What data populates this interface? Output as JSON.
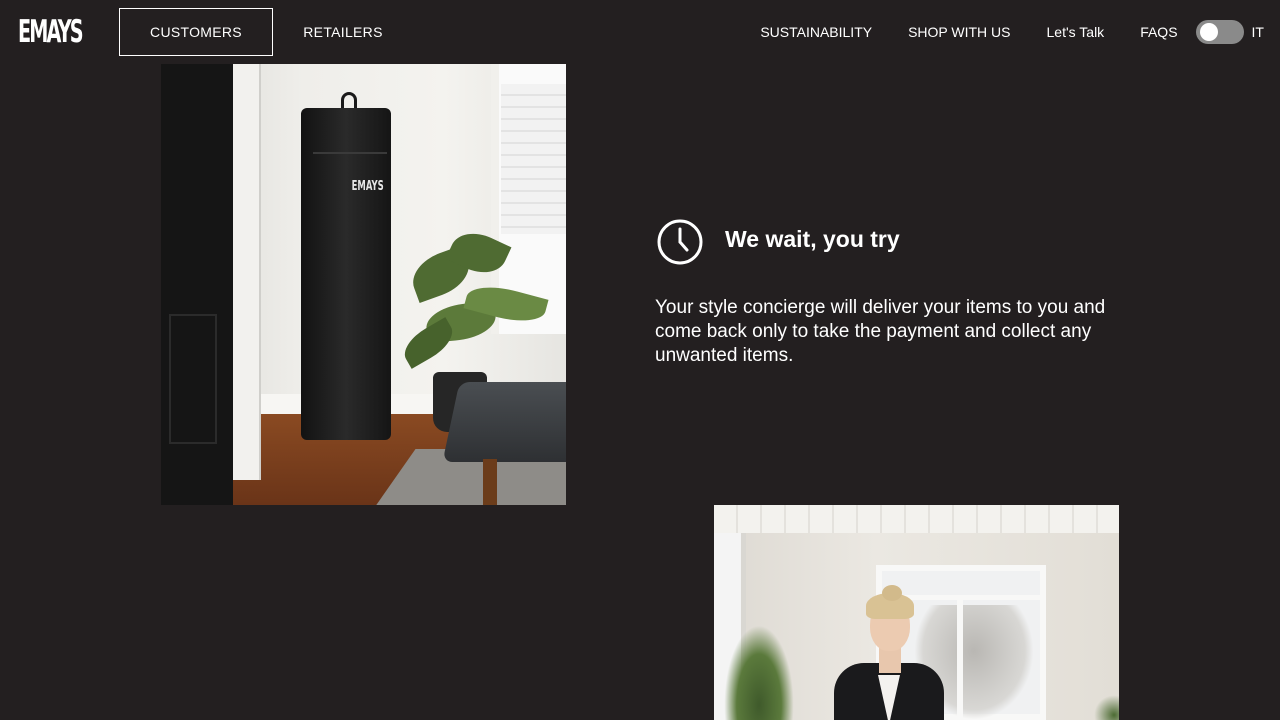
{
  "header": {
    "logo": "EMAYS",
    "tabs": [
      {
        "label": "CUSTOMERS",
        "active": true
      },
      {
        "label": "RETAILERS",
        "active": false
      }
    ],
    "links": [
      "SUSTAINABILITY",
      "SHOP WITH US",
      "Let's Talk",
      "FAQS"
    ],
    "language_toggle": {
      "on": false,
      "label": "IT"
    }
  },
  "photo1": {
    "bag_logo": "EMAYS"
  },
  "feature": {
    "icon": "clock-icon",
    "title": "We wait, you try",
    "text": "Your style concierge will deliver your items to you and come back only to take the payment and collect any unwanted items."
  },
  "colors": {
    "background": "#231f20",
    "text": "#ffffff",
    "toggle_track": "#8a8a8a"
  }
}
